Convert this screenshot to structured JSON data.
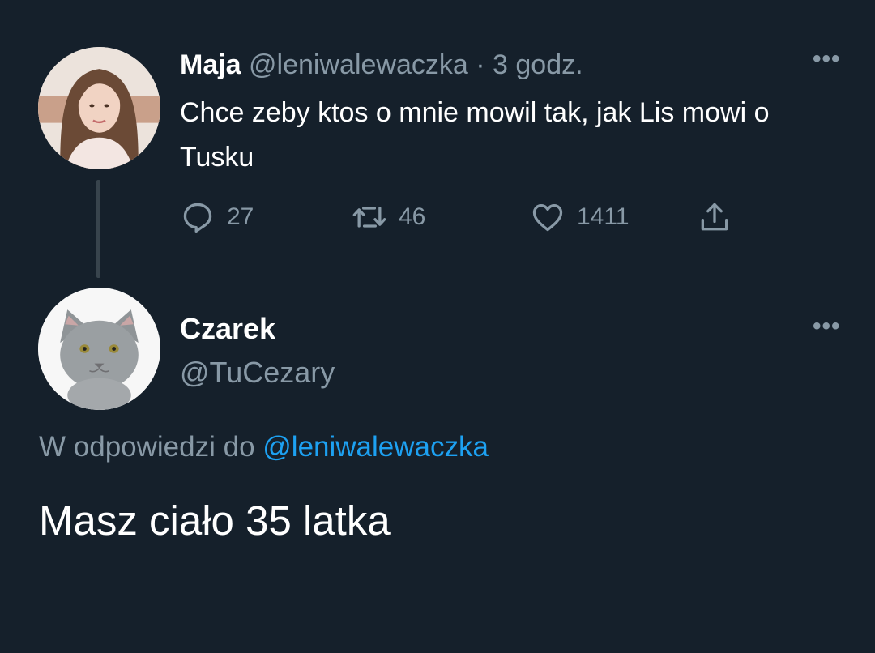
{
  "tweet1": {
    "author_name": "Maja",
    "handle": "@leniwalewaczka",
    "separator": " · ",
    "time": "3 godz.",
    "text": "Chce zeby ktos o mnie mowil tak, jak Lis mowi o Tusku",
    "more_label": "•••",
    "replies": "27",
    "retweets": "46",
    "likes": "1411"
  },
  "tweet2": {
    "author_name": "Czarek",
    "handle": "@TuCezary",
    "more_label": "•••",
    "reply_to_prefix": "W odpowiedzi do ",
    "reply_to_handle": "@leniwalewaczka",
    "text": "Masz ciało 35 latka"
  },
  "icons": {
    "reply": "reply-icon",
    "retweet": "retweet-icon",
    "like": "heart-icon",
    "share": "share-icon"
  },
  "colors": {
    "background": "#15202b",
    "secondary_text": "#8899a6",
    "link": "#1da1f2"
  }
}
